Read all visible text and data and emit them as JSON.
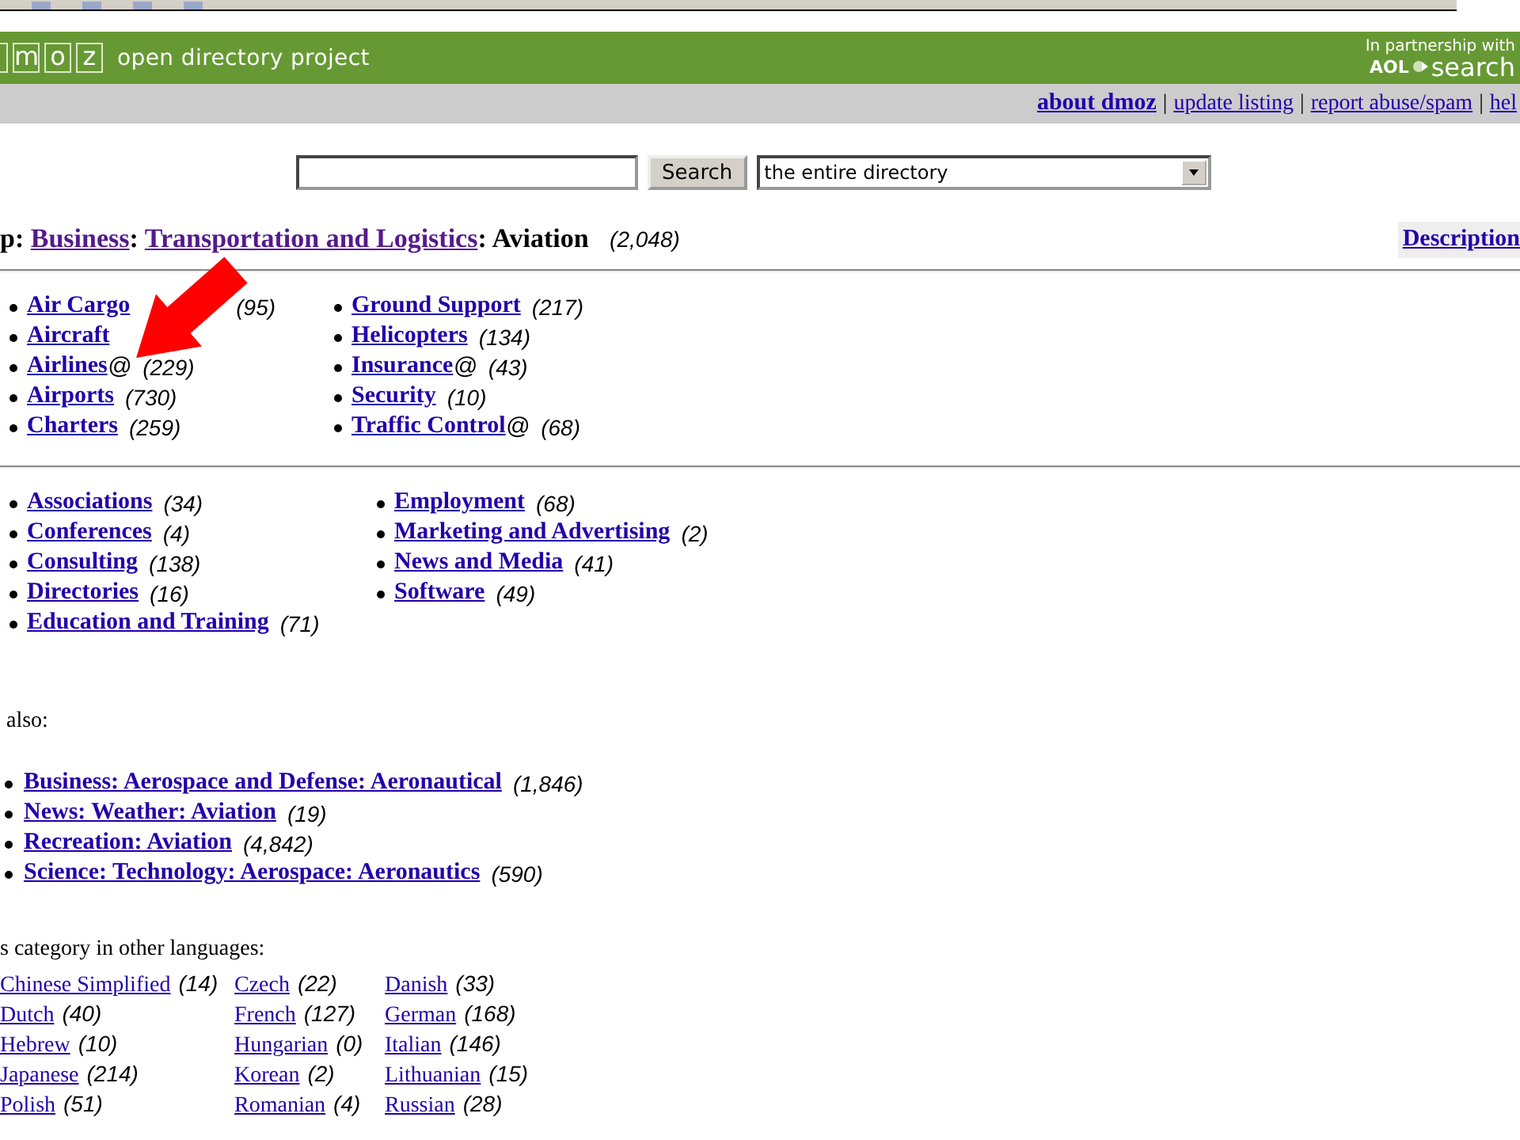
{
  "header": {
    "logo_letters": [
      "m",
      "o",
      "z"
    ],
    "tagline": "open directory project",
    "partner_text": "In partnership with",
    "partner_logo": "AOL",
    "partner_search": "search"
  },
  "nav_links": [
    {
      "label": "about dmoz",
      "bold": true
    },
    {
      "separator": "|",
      "label": "update listing",
      "bold": false
    },
    {
      "separator": "|",
      "label": "report abuse/spam",
      "bold": false
    },
    {
      "separator": "|",
      "label": "hel",
      "bold": false
    }
  ],
  "search": {
    "button": "Search",
    "scope": "the entire directory"
  },
  "breadcrumb": {
    "items": [
      {
        "label": "p",
        "link": false,
        "suffix": ":"
      },
      {
        "label": "Business",
        "link": true,
        "suffix": ":"
      },
      {
        "label": "Transportation and Logistics",
        "link": true,
        "suffix": ":"
      },
      {
        "label": "Aviation",
        "link": false
      }
    ],
    "count": "(2,048)"
  },
  "description_button": "Description",
  "subcategories": [
    [
      {
        "label": "Air Cargo",
        "count": "(95)"
      },
      {
        "label": "Aircraft"
      },
      {
        "label": "Airlines",
        "at": "@",
        "count": "(229)"
      },
      {
        "label": "Airports",
        "count": "(730)"
      },
      {
        "label": "Charters",
        "count": "(259)"
      }
    ],
    [
      {
        "label": "Ground Support",
        "count": "(217)"
      },
      {
        "label": "Helicopters",
        "count": "(134)"
      },
      {
        "label": "Insurance",
        "at": "@",
        "count": "(43)"
      },
      {
        "label": "Security",
        "count": "(10)"
      },
      {
        "label": "Traffic Control",
        "at": "@",
        "count": "(68)"
      }
    ]
  ],
  "topics": [
    [
      {
        "label": "Associations",
        "count": "(34)"
      },
      {
        "label": "Conferences",
        "count": "(4)"
      },
      {
        "label": "Consulting",
        "count": "(138)"
      },
      {
        "label": "Directories",
        "count": "(16)"
      },
      {
        "label": "Education and Training",
        "count": "(71)"
      }
    ],
    [
      {
        "label": "Employment",
        "count": "(68)"
      },
      {
        "label": "Marketing and Advertising",
        "count": "(2)"
      },
      {
        "label": "News and Media",
        "count": "(41)"
      },
      {
        "label": "Software",
        "count": "(49)"
      }
    ]
  ],
  "see_also": {
    "heading": "also:",
    "items": [
      {
        "label": "Business: Aerospace and Defense: Aeronautical",
        "count": "(1,846)"
      },
      {
        "label": "News: Weather: Aviation",
        "count": "(19)"
      },
      {
        "label": "Recreation: Aviation",
        "count": "(4,842)"
      },
      {
        "label": "Science: Technology: Aerospace: Aeronautics",
        "count": "(590)"
      }
    ]
  },
  "languages": {
    "heading": "s category in other languages:",
    "columns": [
      [
        {
          "label": "Chinese Simplified",
          "count": "(14)"
        },
        {
          "label": "Dutch",
          "count": "(40)"
        },
        {
          "label": "Hebrew",
          "count": "(10)"
        },
        {
          "label": "Japanese",
          "count": "(214)"
        },
        {
          "label": "Polish",
          "count": "(51)"
        }
      ],
      [
        {
          "label": "Czech",
          "count": "(22)"
        },
        {
          "label": "French",
          "count": "(127)"
        },
        {
          "label": "Hungarian",
          "count": "(0)"
        },
        {
          "label": "Korean",
          "count": "(2)"
        },
        {
          "label": "Romanian",
          "count": "(4)"
        }
      ],
      [
        {
          "label": "Danish",
          "count": "(33)"
        },
        {
          "label": "German",
          "count": "(168)"
        },
        {
          "label": "Italian",
          "count": "(146)"
        },
        {
          "label": "Lithuanian",
          "count": "(15)"
        },
        {
          "label": "Russian",
          "count": "(28)"
        }
      ]
    ]
  }
}
